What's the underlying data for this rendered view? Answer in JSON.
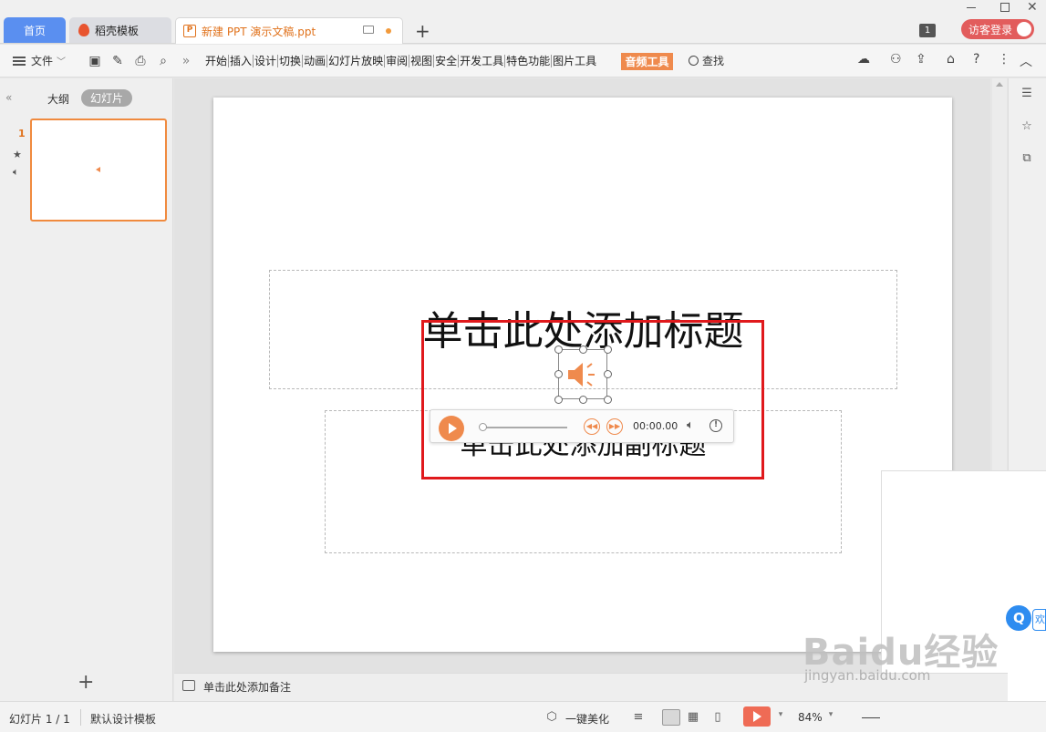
{
  "tabs": {
    "home": "首页",
    "template": "稻壳模板",
    "document": "新建 PPT 演示文稿.ppt",
    "add": "+"
  },
  "window": {
    "count_badge": "1",
    "login_label": "访客登录"
  },
  "ribbon": {
    "file_label": "文件",
    "more": "»",
    "tabs": [
      "开始",
      "插入",
      "设计",
      "切换",
      "动画",
      "幻灯片放映",
      "审阅",
      "视图",
      "安全",
      "开发工具",
      "特色功能",
      "图片工具"
    ],
    "active_tab": "音频工具",
    "find_label": "查找"
  },
  "left_panel": {
    "collapse": "«",
    "tab_outline": "大纲",
    "tab_slides": "幻灯片",
    "slide_number": "1",
    "add_slide": "+"
  },
  "slide": {
    "title_placeholder": "单击此处添加标题",
    "subtitle_placeholder": "单击此处添加副标题"
  },
  "player": {
    "time": "00:00.00",
    "progress": 0
  },
  "notes": {
    "placeholder": "单击此处添加备注"
  },
  "status_bar": {
    "slide_count": "幻灯片 1 / 1",
    "design_template": "默认设计模板",
    "beautify": "一键美化",
    "zoom": "84%"
  },
  "popup": {
    "tag": "欢"
  },
  "watermark": {
    "brand": "Baidu经验",
    "url": "jingyan.baidu.com"
  },
  "colors": {
    "accent_orange": "#ef8a4d",
    "home_tab_blue": "#5a8ff0",
    "highlight_red": "#e0191c",
    "login_red": "#e25c5c"
  }
}
